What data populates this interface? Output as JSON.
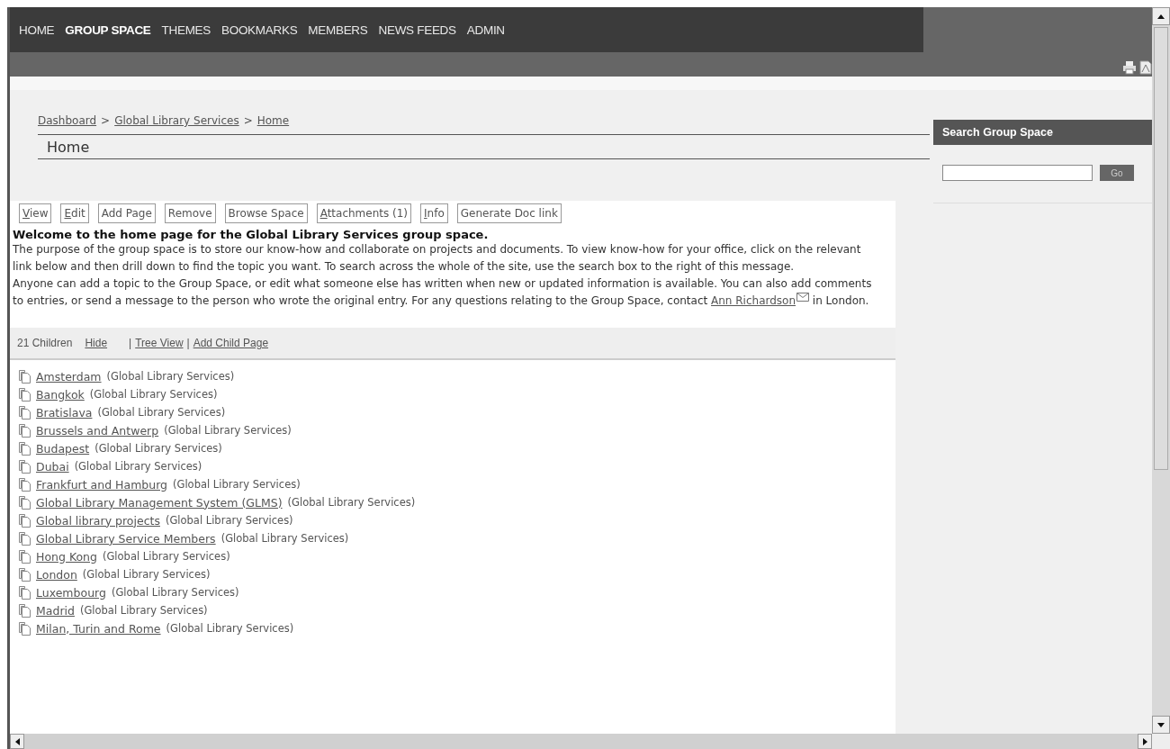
{
  "nav": {
    "items": [
      {
        "label": "HOME",
        "selected": false
      },
      {
        "label": "GROUP SPACE",
        "selected": true
      },
      {
        "label": "THEMES",
        "selected": false
      },
      {
        "label": "BOOKMARKS",
        "selected": false
      },
      {
        "label": "MEMBERS",
        "selected": false
      },
      {
        "label": "NEWS FEEDS",
        "selected": false
      },
      {
        "label": "ADMIN",
        "selected": false
      }
    ]
  },
  "breadcrumb": [
    {
      "kind": "link",
      "text": "Dashboard"
    },
    {
      "kind": "separator",
      "text": ">"
    },
    {
      "kind": "link",
      "text": "Global Library Services"
    },
    {
      "kind": "separator",
      "text": ">"
    },
    {
      "kind": "link",
      "text": "Home"
    }
  ],
  "page_title": "Home",
  "actions": [
    {
      "label": "View",
      "mnemonic": true
    },
    {
      "label": "Edit",
      "mnemonic": true
    },
    {
      "label": "Add Page",
      "mnemonic": false
    },
    {
      "label": "Remove",
      "mnemonic": false
    },
    {
      "label": "Browse Space",
      "mnemonic": false
    },
    {
      "label": "Attachments (1)",
      "mnemonic": true
    },
    {
      "label": "Info",
      "mnemonic": true
    },
    {
      "label": "Generate Doc link",
      "mnemonic": false
    }
  ],
  "intro": {
    "heading": "Welcome to the home page for the Global Library Services group space.",
    "paragraph_1": "The purpose of the group space is to store our know-how and collaborate on projects and documents. To view know-how for your office, click on the relevant link below and then drill down to find the topic you want. To search across the whole of the site, use the search box to the right of this message.",
    "paragraph_2": {
      "before": "Anyone can add a topic to the Group Space, or edit what someone else has written when new or updated information is available. You can also add comments to entries, or send a message to the person who wrote the original entry. For any questions relating to the Group Space, contact ",
      "link": "Ann Richardson",
      "after": " in London."
    }
  },
  "children_bar": [
    {
      "kind": "count",
      "text": "21 Children"
    },
    {
      "kind": "link",
      "text": "Hide"
    },
    {
      "kind": "separator",
      "text": "|"
    },
    {
      "kind": "link",
      "text": "Tree View"
    },
    {
      "kind": "separator",
      "text": "|"
    },
    {
      "kind": "link",
      "text": "Add Child Page"
    }
  ],
  "children": [
    {
      "name": "Amsterdam",
      "space": "(Global Library Services)"
    },
    {
      "name": "Bangkok",
      "space": "(Global Library Services)"
    },
    {
      "name": "Bratislava",
      "space": "(Global Library Services)"
    },
    {
      "name": "Brussels and Antwerp",
      "space": "(Global Library Services)"
    },
    {
      "name": "Budapest",
      "space": "(Global Library Services)"
    },
    {
      "name": "Dubai",
      "space": "(Global Library Services)"
    },
    {
      "name": "Frankfurt and Hamburg",
      "space": "(Global Library Services)"
    },
    {
      "name": "Global Library Management System (GLMS)",
      "space": "(Global Library Services)"
    },
    {
      "name": "Global library projects",
      "space": "(Global Library Services)"
    },
    {
      "name": "Global Library Service Members",
      "space": "(Global Library Services)"
    },
    {
      "name": "Hong Kong",
      "space": "(Global Library Services)"
    },
    {
      "name": "London",
      "space": "(Global Library Services)"
    },
    {
      "name": "Luxembourg",
      "space": "(Global Library Services)"
    },
    {
      "name": "Madrid",
      "space": "(Global Library Services)"
    },
    {
      "name": "Milan, Turin and Rome",
      "space": "(Global Library Services)"
    }
  ],
  "sidebar": {
    "title": "Search Group Space",
    "button": "Go"
  }
}
